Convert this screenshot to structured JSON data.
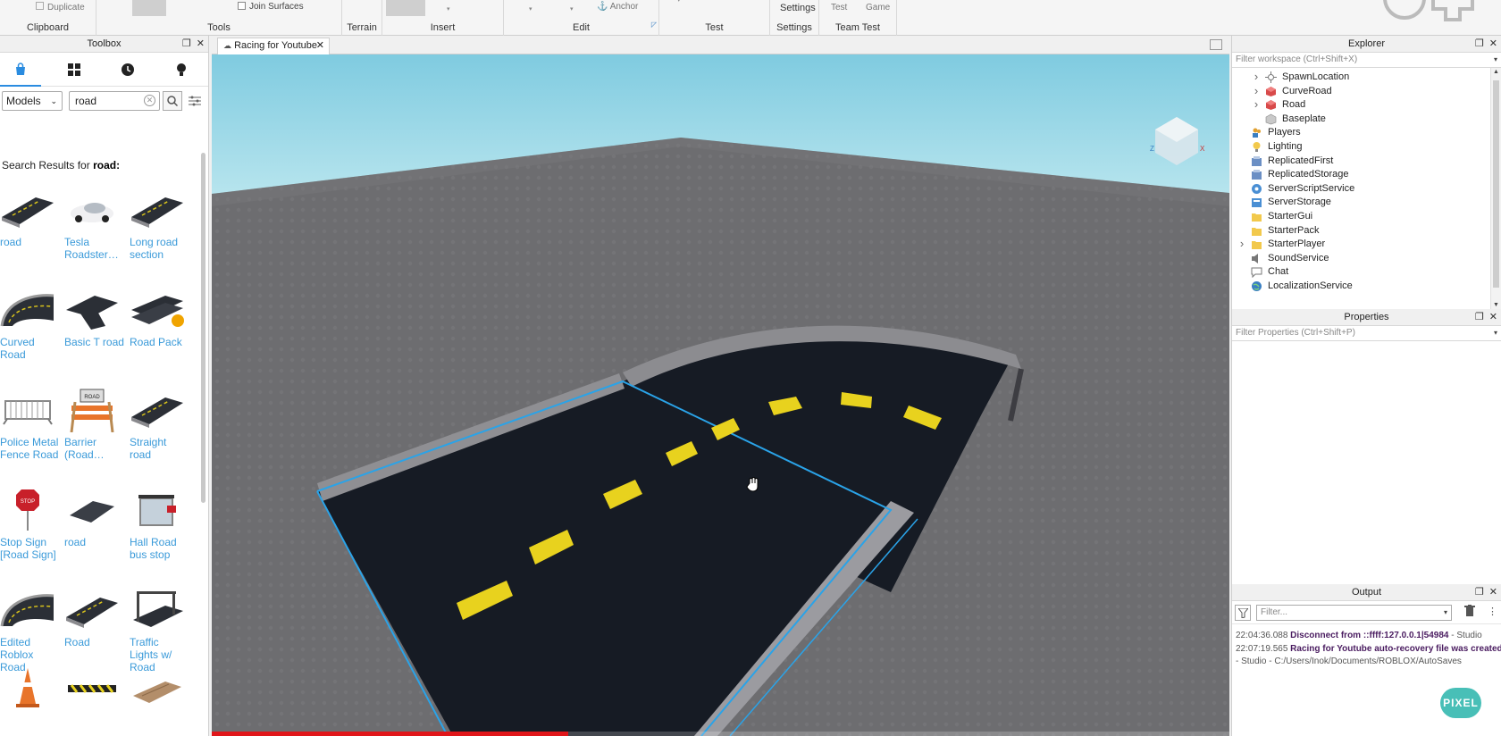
{
  "ribbon": {
    "clipboard": {
      "label": "Clipboard",
      "duplicate": "Duplicate"
    },
    "tools": {
      "label": "Tools",
      "join_surfaces": "Join Surfaces"
    },
    "terrain": {
      "label": "Terrain"
    },
    "insert": {
      "label": "Insert"
    },
    "edit": {
      "label": "Edit",
      "anchor": "Anchor"
    },
    "test": {
      "label": "Test"
    },
    "settings": {
      "label": "Settings",
      "button": "Settings"
    },
    "team_test": {
      "label": "Team Test",
      "test": "Test",
      "game": "Game"
    }
  },
  "toolbox": {
    "title": "Toolbox",
    "tabs": [
      "marketplace-icon",
      "inventory-icon",
      "recent-icon",
      "creations-icon"
    ],
    "category": "Models",
    "search_value": "road",
    "results_prefix": "Search Results for",
    "results_query": "road:",
    "items": [
      {
        "name": "road",
        "icon": "road-segment"
      },
      {
        "name": "Tesla Roadster…",
        "icon": "white-car"
      },
      {
        "name": "Long road section",
        "icon": "road-segment"
      },
      {
        "name": "Curved Road",
        "icon": "curved-road"
      },
      {
        "name": "Basic T road",
        "icon": "t-road"
      },
      {
        "name": "Road Pack",
        "icon": "road-pack"
      },
      {
        "name": "Police Metal Fence Road",
        "icon": "metal-fence"
      },
      {
        "name": "Barrier (Road…",
        "icon": "road-closed-barrier"
      },
      {
        "name": "Straight road",
        "icon": "road-segment"
      },
      {
        "name": "Stop Sign [Road Sign]",
        "icon": "stop-sign"
      },
      {
        "name": "road",
        "icon": "road-tile"
      },
      {
        "name": "Hall Road bus stop",
        "icon": "bus-stop"
      },
      {
        "name": "Edited Roblox Road",
        "icon": "curved-road"
      },
      {
        "name": "Road",
        "icon": "road-segment"
      },
      {
        "name": "Traffic Lights w/ Road",
        "icon": "traffic-lights"
      },
      {
        "name": "",
        "icon": "traffic-cone"
      },
      {
        "name": "",
        "icon": "striped-barrier"
      },
      {
        "name": "",
        "icon": "wood-plank"
      }
    ]
  },
  "viewport": {
    "tab_title": "Racing for Youtube",
    "video_progress": 0.35
  },
  "explorer": {
    "title": "Explorer",
    "filter_placeholder": "Filter workspace (Ctrl+Shift+X)",
    "items": [
      {
        "label": "SpawnLocation",
        "level": 1,
        "expandable": true,
        "icon": "spawn-icon"
      },
      {
        "label": "CurveRoad",
        "level": 1,
        "expandable": true,
        "icon": "model-icon"
      },
      {
        "label": "Road",
        "level": 1,
        "expandable": true,
        "icon": "model-icon"
      },
      {
        "label": "Baseplate",
        "level": 1,
        "expandable": false,
        "icon": "part-icon"
      },
      {
        "label": "Players",
        "level": 0,
        "expandable": false,
        "icon": "players-icon"
      },
      {
        "label": "Lighting",
        "level": 0,
        "expandable": false,
        "icon": "lighting-icon"
      },
      {
        "label": "ReplicatedFirst",
        "level": 0,
        "expandable": false,
        "icon": "replicated-icon"
      },
      {
        "label": "ReplicatedStorage",
        "level": 0,
        "expandable": false,
        "icon": "replicated-icon"
      },
      {
        "label": "ServerScriptService",
        "level": 0,
        "expandable": false,
        "icon": "server-script-icon"
      },
      {
        "label": "ServerStorage",
        "level": 0,
        "expandable": false,
        "icon": "server-storage-icon"
      },
      {
        "label": "StarterGui",
        "level": 0,
        "expandable": false,
        "icon": "folder-icon"
      },
      {
        "label": "StarterPack",
        "level": 0,
        "expandable": false,
        "icon": "folder-icon"
      },
      {
        "label": "StarterPlayer",
        "level": 0,
        "expandable": true,
        "icon": "folder-icon"
      },
      {
        "label": "SoundService",
        "level": 0,
        "expandable": false,
        "icon": "sound-icon"
      },
      {
        "label": "Chat",
        "level": 0,
        "expandable": false,
        "icon": "chat-icon"
      },
      {
        "label": "LocalizationService",
        "level": 0,
        "expandable": false,
        "icon": "globe-icon"
      }
    ]
  },
  "properties": {
    "title": "Properties",
    "filter_placeholder": "Filter Properties (Ctrl+Shift+P)"
  },
  "output": {
    "title": "Output",
    "filter_placeholder": "Filter...",
    "lines": [
      {
        "time": "22:04:36.088",
        "message": "Disconnect from ::ffff:127.0.0.1|54984",
        "source": "- Studio"
      },
      {
        "time": "22:07:19.565",
        "message": "Racing for Youtube auto-recovery file was created",
        "source": ""
      },
      {
        "time": "",
        "message": "",
        "source": "- Studio - C:/Users/Inok/Documents/ROBLOX/AutoSaves"
      }
    ]
  },
  "watermark": "PIXEL",
  "colors": {
    "accent": "#2a8ce0",
    "link": "#3a9ad9",
    "sky": "#8fd2e3",
    "baseplate": "#6d6d70",
    "road": "#161b24",
    "road_stripe": "#e8d21e",
    "selection": "#2aa3e8"
  }
}
